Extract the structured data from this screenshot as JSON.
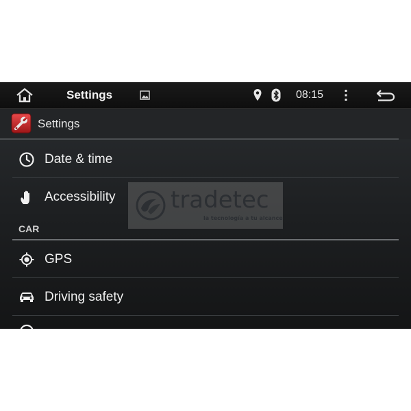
{
  "status_bar": {
    "title": "Settings",
    "time": "08:15",
    "icons": [
      "home-icon",
      "gallery-icon",
      "location-pin-icon",
      "bluetooth-icon",
      "overflow-menu-icon",
      "back-icon"
    ]
  },
  "action_bar": {
    "app_title": "Settings",
    "app_icon": "settings-wrench-icon"
  },
  "list": {
    "items": [
      {
        "label": "Date & time",
        "icon": "clock-icon"
      },
      {
        "label": "Accessibility",
        "icon": "hand-icon"
      }
    ],
    "section_header": "CAR",
    "car_items": [
      {
        "label": "GPS",
        "icon": "gps-icon"
      },
      {
        "label": "Driving safety",
        "icon": "car-icon"
      }
    ]
  },
  "watermark": {
    "brand": "tradetec",
    "tagline": "la tecnología a tu alcance"
  },
  "colors": {
    "accent_red": "#c0282a",
    "text": "#f0f0f0"
  }
}
